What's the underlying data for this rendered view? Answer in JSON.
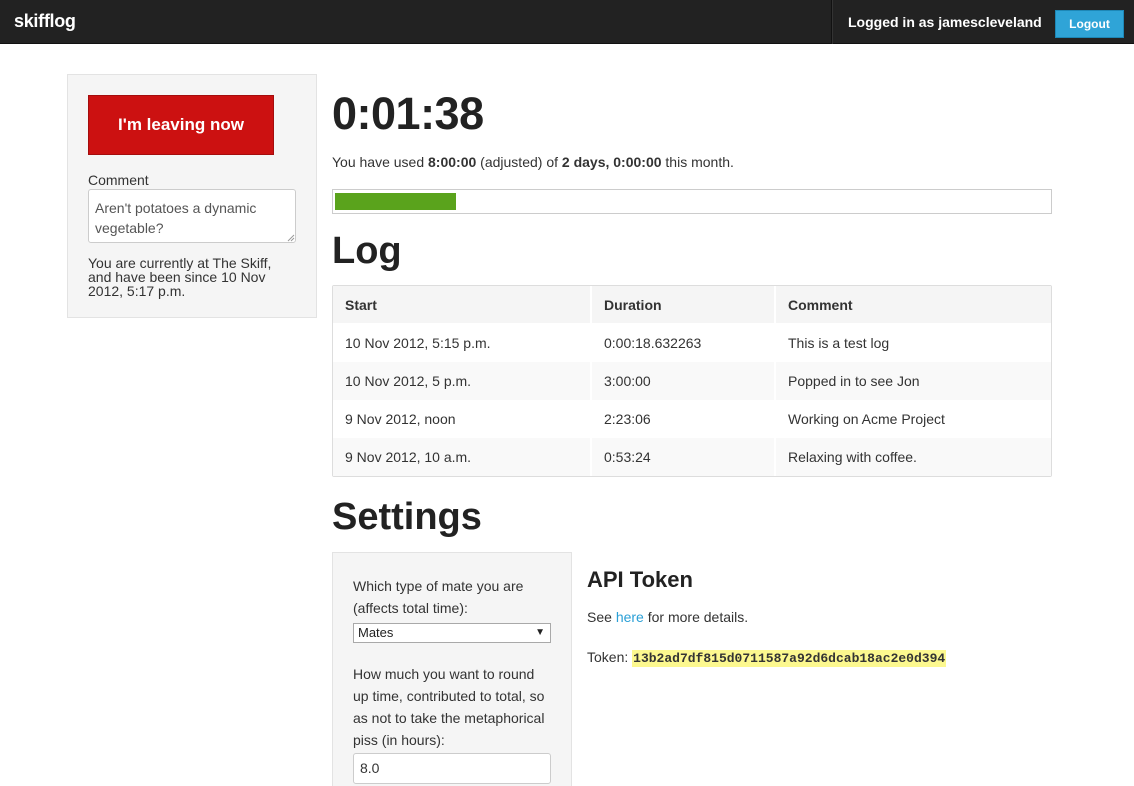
{
  "navbar": {
    "brand": "skifflog",
    "logged_in": "Logged in as jamescleveland",
    "logout_label": "Logout"
  },
  "sidebar": {
    "leave_label": "I'm leaving now",
    "comment_label": "Comment",
    "comment_value": "Aren't potatoes a dynamic vegetable?",
    "status_text": "You are currently at The Skiff, and have been since 10 Nov 2012, 5:17 p.m."
  },
  "timer": "0:01:38",
  "usage": {
    "prefix": "You have used ",
    "used": "8:00:00",
    "middle": " (adjusted) of ",
    "total": "2 days, 0:00:00",
    "suffix": " this month.",
    "progress_fraction": 0.17,
    "progress_color": "#5aa31c"
  },
  "log": {
    "title": "Log",
    "headers": [
      "Start",
      "Duration",
      "Comment"
    ],
    "rows": [
      [
        "10 Nov 2012, 5:15 p.m.",
        "0:00:18.632263",
        "This is a test log"
      ],
      [
        "10 Nov 2012, 5 p.m.",
        "3:00:00",
        "Popped in to see Jon"
      ],
      [
        "9 Nov 2012, noon",
        "2:23:06",
        "Working on Acme Project"
      ],
      [
        "9 Nov 2012, 10 a.m.",
        "0:53:24",
        "Relaxing with coffee."
      ]
    ]
  },
  "settings": {
    "title": "Settings",
    "mate_label": "Which type of mate you are (affects total time):",
    "mate_selected": "Mates",
    "round_label": "How much you want to round up time, contributed to total, so as not to take the metaphorical piss (in hours):",
    "round_value": "8.0"
  },
  "api": {
    "title": "API Token",
    "see_prefix": "See ",
    "see_link": "here",
    "see_suffix": " for more details.",
    "token_label": "Token: ",
    "token": "13b2ad7df815d0711587a92d6dcab18ac2e0d394"
  },
  "colors": {
    "navbar": "#222222",
    "leave_button": "#cc1111",
    "logout_button": "#2fa4d7",
    "link": "#2a9fd6",
    "token_highlight": "#fcf88f"
  }
}
